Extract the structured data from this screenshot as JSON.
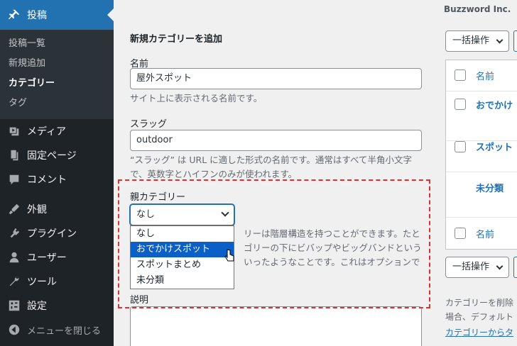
{
  "sidebar": {
    "active_menu": "投稿",
    "submenu": [
      "投稿一覧",
      "新規追加",
      "カテゴリー",
      "タグ"
    ],
    "items": [
      {
        "label": "メディア",
        "icon": "media-icon"
      },
      {
        "label": "固定ページ",
        "icon": "page-icon"
      },
      {
        "label": "コメント",
        "icon": "comment-icon"
      },
      {
        "label": "外観",
        "icon": "appearance-icon"
      },
      {
        "label": "プラグイン",
        "icon": "plugin-icon"
      },
      {
        "label": "ユーザー",
        "icon": "user-icon"
      },
      {
        "label": "ツール",
        "icon": "wrench-icon"
      },
      {
        "label": "設定",
        "icon": "settings-icon"
      }
    ],
    "collapse_label": "メニューを閉じる"
  },
  "form": {
    "section_title": "新規カテゴリーを追加",
    "name_label": "名前",
    "name_value": "屋外スポット",
    "name_desc": "サイト上に表示される名前です。",
    "slug_label": "スラッグ",
    "slug_value": "outdoor",
    "slug_desc_1": "“スラッグ” は URL に適した形式の名前です。通常はすべて半角小文字",
    "slug_desc_2": "で、英数字とハイフンのみが使われます。",
    "parent_label": "親カテゴリー",
    "parent_selected": "なし",
    "parent_options": [
      "なし",
      "おでかけスポット",
      "スポットまとめ",
      "未分類"
    ],
    "parent_highlighted_index": 1,
    "parent_desc_1": "リーは階層構造を持つことができます。たと",
    "parent_desc_2": "ゴリーの下にビバップやビッグバンドという",
    "parent_desc_3": "いったようなことです。これはオプションで",
    "description_label": "説明"
  },
  "right": {
    "brand": "Buzzword Inc.",
    "bulk_action": "一括操作",
    "table_header": "名前",
    "rows": [
      "おでかけ",
      "スポット",
      "未分類"
    ],
    "table_footer": "名前",
    "note_1": "カテゴリーを削除",
    "note_2": "場合、デフォルト",
    "note_link": "カテゴリーからタ"
  },
  "colors": {
    "accent": "#2271b1",
    "highlight_frame": "#e0302d",
    "sidebar_bg": "#1d2327"
  }
}
